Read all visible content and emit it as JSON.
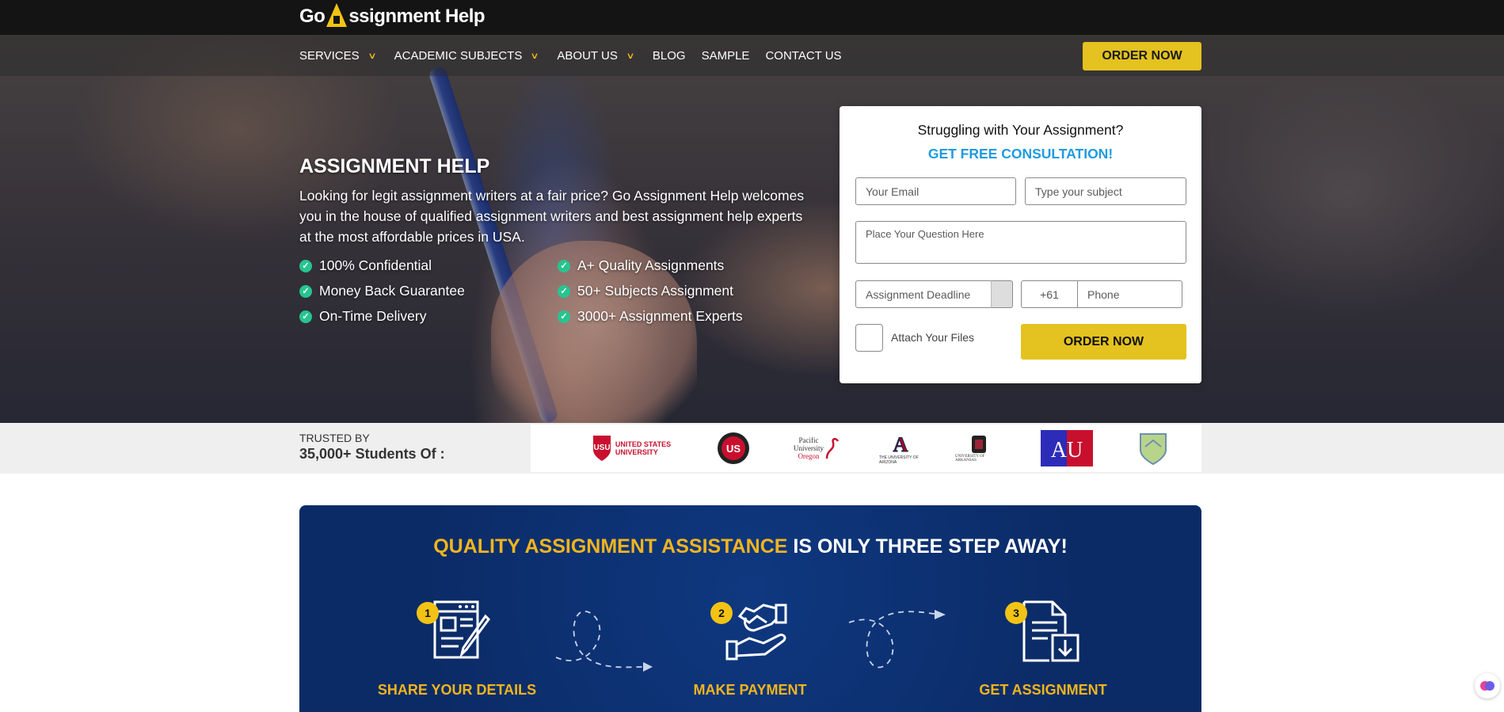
{
  "brand": {
    "logo_pre": "Go",
    "logo_post": "ssignment Help"
  },
  "nav": {
    "items": [
      {
        "label": "SERVICES",
        "has_dropdown": true
      },
      {
        "label": "ACADEMIC SUBJECTS",
        "has_dropdown": true
      },
      {
        "label": "ABOUT US",
        "has_dropdown": true
      },
      {
        "label": "BLOG",
        "has_dropdown": false
      },
      {
        "label": "SAMPLE",
        "has_dropdown": false
      },
      {
        "label": "CONTACT US",
        "has_dropdown": false
      }
    ],
    "order_button": "ORDER NOW"
  },
  "hero": {
    "title": "ASSIGNMENT HELP",
    "description": "Looking for legit assignment writers at a fair price? Go Assignment Help welcomes you in the house of qualified assignment writers and best assignment help experts at the most affordable prices in USA.",
    "features": [
      "100% Confidential",
      "A+ Quality Assignments",
      "Money Back Guarantee",
      "50+ Subjects Assignment",
      "On-Time Delivery",
      "3000+ Assignment Experts"
    ]
  },
  "form": {
    "heading": "Struggling with Your Assignment?",
    "subheading": "GET FREE CONSULTATION!",
    "email_placeholder": "Your Email",
    "subject_placeholder": "Type your subject",
    "question_placeholder": "Place Your Question Here",
    "deadline_placeholder": "Assignment Deadline",
    "country_code": "+61",
    "phone_placeholder": "Phone",
    "attach_label": "Attach Your Files",
    "submit_label": "ORDER NOW"
  },
  "trusted": {
    "small": "TRUSTED BY",
    "big": "35,000+ Students Of :",
    "logos": [
      {
        "name": "united-states-university",
        "line1": "UNITED STATES",
        "line2": "UNIVERSITY",
        "color": "#c8102e"
      },
      {
        "name": "us-seal",
        "text": "US"
      },
      {
        "name": "pacific-university-oregon",
        "line1": "Pacific",
        "line2": "University",
        "line3": "Oregon"
      },
      {
        "name": "university-of-arizona",
        "text": "A",
        "caption": "THE UNIVERSITY OF ARIZONA"
      },
      {
        "name": "university-of-arkansas",
        "caption": "UNIVERSITY OF ARKANSAS"
      },
      {
        "name": "american-university",
        "text": "AU"
      },
      {
        "name": "shield-logo"
      }
    ]
  },
  "steps": {
    "title_highlight": "QUALITY ASSIGNMENT ASSISTANCE",
    "title_rest": "IS ONLY THREE STEP AWAY!",
    "items": [
      {
        "number": "1",
        "label": "SHARE YOUR DETAILS",
        "icon": "form-pencil-icon"
      },
      {
        "number": "2",
        "label": "MAKE PAYMENT",
        "icon": "handshake-icon"
      },
      {
        "number": "3",
        "label": "GET ASSIGNMENT",
        "icon": "document-download-icon"
      }
    ]
  },
  "colors": {
    "accent_yellow": "#e4c21f",
    "consult_blue": "#1e9be0",
    "steps_navy": "#0b2b66",
    "check_green": "#27c490"
  }
}
